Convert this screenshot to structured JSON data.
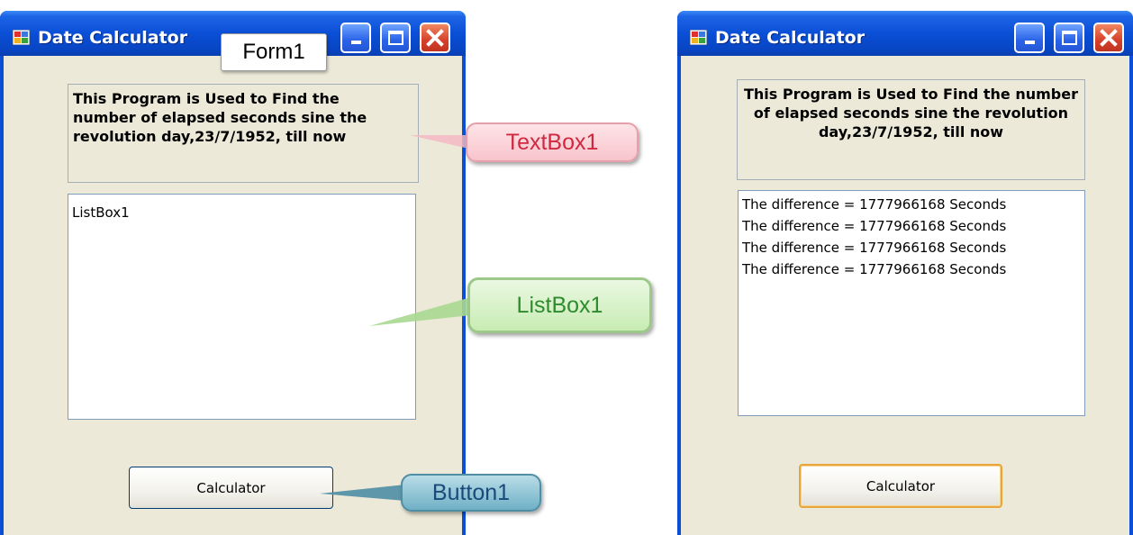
{
  "left_window": {
    "title": "Date Calculator",
    "description": "This Program is Used to Find the number of elapsed seconds sine the revolution day,23/7/1952, till now",
    "listbox_items": [
      "ListBox1"
    ],
    "button_label": "Calculator"
  },
  "right_window": {
    "title": "Date Calculator",
    "description": "This Program is Used to Find the number of elapsed seconds sine the revolution day,23/7/1952, till now",
    "listbox_items": [
      "The difference = 1777966168 Seconds",
      "The difference = 1777966168 Seconds",
      "The difference = 1777966168 Seconds",
      "The difference = 1777966168 Seconds"
    ],
    "button_label": "Calculator"
  },
  "callouts": {
    "form": "Form1",
    "textbox": "TextBox1",
    "listbox": "ListBox1",
    "button": "Button1"
  },
  "colors": {
    "titlebar": "#0a4fd6",
    "client_bg": "#ece9d8",
    "close_button": "#d6402a",
    "textbox_callout": "#f8c4cc",
    "listbox_callout": "#c8ecb3",
    "button_callout": "#6fb0c6"
  },
  "icons": [
    "app-icon",
    "minimize-icon",
    "maximize-icon",
    "close-icon"
  ]
}
